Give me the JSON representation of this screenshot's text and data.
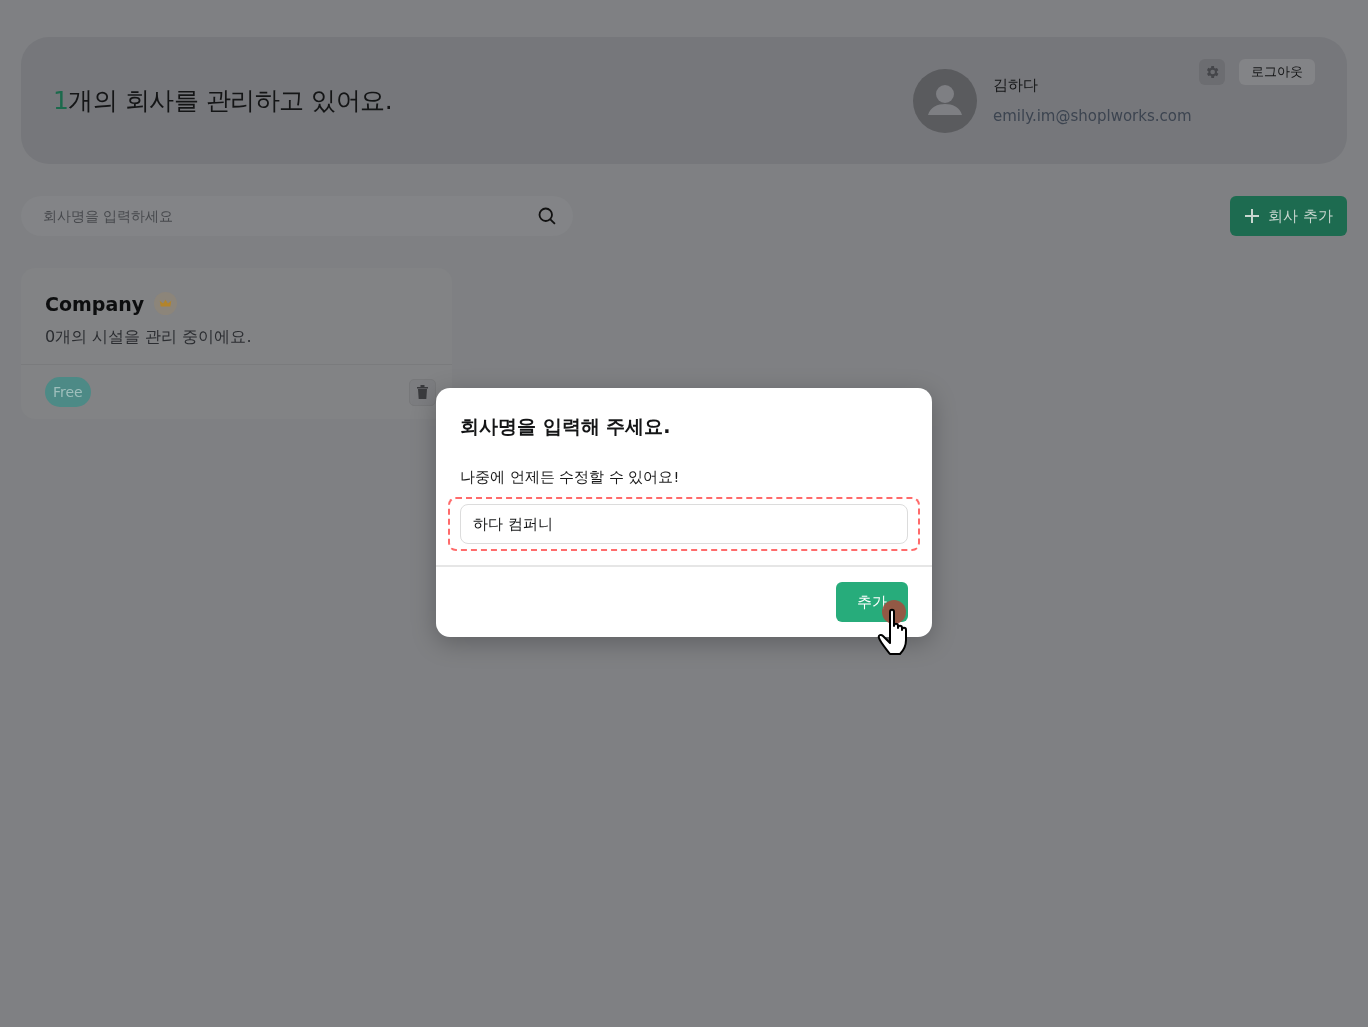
{
  "header": {
    "count": "1",
    "suffix": "개의 회사를 관리하고 있어요.",
    "user": {
      "name": "김하다",
      "email": "emily.im@shoplworks.com"
    },
    "logout": "로그아웃"
  },
  "search": {
    "placeholder": "회사명을 입력하세요"
  },
  "add_button": "회사 추가",
  "companies": [
    {
      "name": "Company",
      "premium": true,
      "facilities": "0개의 시설을 관리 중이에요.",
      "plan": "Free"
    }
  ],
  "dialog": {
    "title": "회사명을 입력해 주세요.",
    "hint": "나중에 언제든 수정할 수 있어요!",
    "field": {
      "value": "하다 컴퍼니",
      "highlighted": true
    },
    "confirm": "추가"
  }
}
